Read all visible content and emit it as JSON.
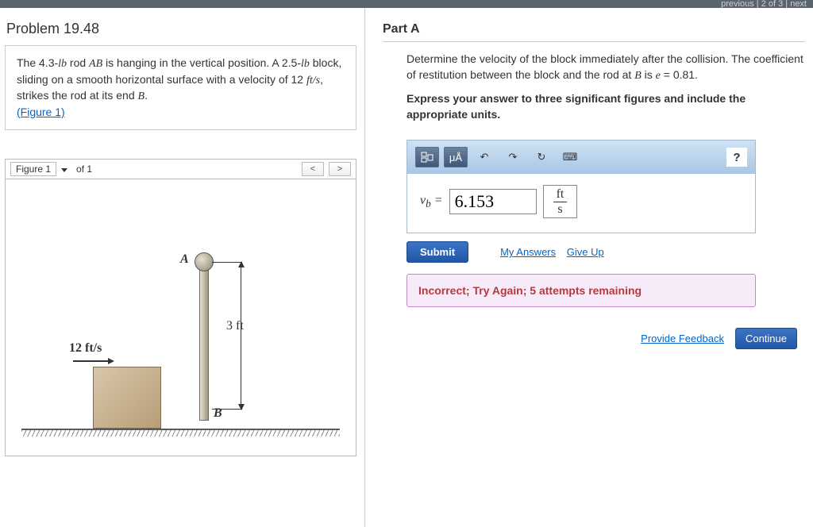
{
  "topbar": {
    "nav_text": "previous | 2 of 3 | next"
  },
  "problem": {
    "title": "Problem 19.48",
    "prompt_html": "The 4.3-lb rod <i>AB</i> is hanging in the vertical position. A 2.5-lb block, sliding on a smooth horizontal surface with a velocity of 12 ft/s, strikes the rod at its end <i>B</i>.",
    "figure_link": "(Figure 1)"
  },
  "figure": {
    "label": "Figure 1",
    "of_text": "of 1",
    "prev": "<",
    "next": ">",
    "velocity_label": "12 ft/s",
    "length_label": "3 ft",
    "point_a": "A",
    "point_b": "B"
  },
  "part": {
    "heading": "Part A",
    "question": "Determine the velocity of the block immediately after the collision. The coefficient of restitution between the block and the rod at B is e = 0.81.",
    "instruction": "Express your answer to three significant figures and include the appropriate units."
  },
  "toolbar": {
    "btn1": "▭",
    "btn2": "μÅ",
    "undo": "↶",
    "redo": "↷",
    "reset": "↻",
    "keyboard": "⌨",
    "help": "?"
  },
  "answer": {
    "var_label": "v_b =",
    "value": "6.153",
    "unit_top": "ft",
    "unit_bot": "s"
  },
  "actions": {
    "submit": "Submit",
    "my_answers": "My Answers",
    "give_up": "Give Up"
  },
  "feedback": {
    "message": "Incorrect; Try Again; 5 attempts remaining"
  },
  "footer": {
    "provide": "Provide Feedback",
    "continue": "Continue"
  }
}
